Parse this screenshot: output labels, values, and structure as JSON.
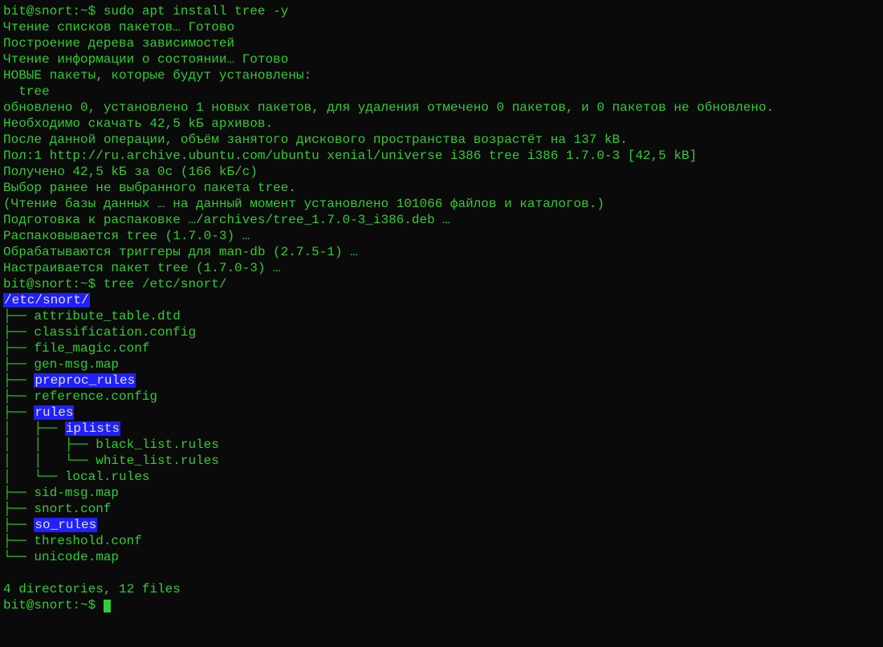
{
  "prompt": {
    "host": "bit@snort",
    "sep": ":~$ ",
    "cmd1": "sudo apt install tree -y",
    "cmd2": "tree /etc/snort/"
  },
  "install": {
    "l1": "Чтение списков пакетов… Готово",
    "l2": "Построение дерева зависимостей",
    "l3": "Чтение информации о состоянии… Готово",
    "l4": "НОВЫЕ пакеты, которые будут установлены:",
    "l5": "  tree",
    "l6": "обновлено 0, установлено 1 новых пакетов, для удаления отмечено 0 пакетов, и 0 пакетов не обновлено.",
    "l7": "Необходимо скачать 42,5 kБ архивов.",
    "l8": "После данной операции, объём занятого дискового пространства возрастёт на 137 kB.",
    "l9": "Пол:1 http://ru.archive.ubuntu.com/ubuntu xenial/universe i386 tree i386 1.7.0-3 [42,5 kB]",
    "l10": "Получено 42,5 kБ за 0с (166 kБ/c)",
    "l11": "Выбор ранее не выбранного пакета tree.",
    "l12": "(Чтение базы данных … на данный момент установлено 101066 файлов и каталогов.)",
    "l13": "Подготовка к распаковке …/archives/tree_1.7.0-3_i386.deb …",
    "l14": "Распаковывается tree (1.7.0-3) …",
    "l15": "Обрабатываются триггеры для man-db (2.7.5-1) …",
    "l16": "Настраивается пакет tree (1.7.0-3) …"
  },
  "tree": {
    "root": "/etc/snort/",
    "l1a": "├── ",
    "l1b": "attribute_table.dtd",
    "l2a": "├── ",
    "l2b": "classification.config",
    "l3a": "├── ",
    "l3b": "file_magic.conf",
    "l4a": "├── ",
    "l4b": "gen-msg.map",
    "l5a": "├── ",
    "l5b": "preproc_rules",
    "l6a": "├── ",
    "l6b": "reference.config",
    "l7a": "├── ",
    "l7b": "rules",
    "l8a": "│   ├── ",
    "l8b": "iplists",
    "l9a": "│   │   ├── ",
    "l9b": "black_list.rules",
    "l10a": "│   │   └── ",
    "l10b": "white_list.rules",
    "l11a": "│   └── ",
    "l11b": "local.rules",
    "l12a": "├── ",
    "l12b": "sid-msg.map",
    "l13a": "├── ",
    "l13b": "snort.conf",
    "l14a": "├── ",
    "l14b": "so_rules",
    "l15a": "├── ",
    "l15b": "threshold.conf",
    "l16a": "└── ",
    "l16b": "unicode.map",
    "summary": "4 directories, 12 files"
  }
}
